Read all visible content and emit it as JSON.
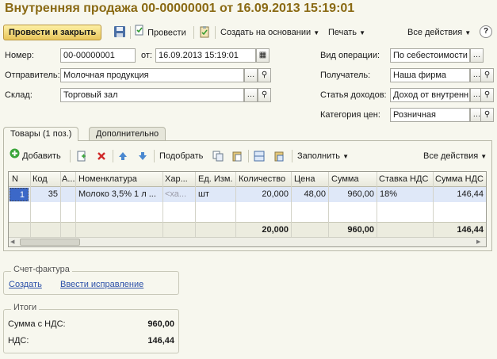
{
  "window": {
    "title": "Внутренняя продажа 00-00000001 от 16.09.2013 15:19:01"
  },
  "toolbar": {
    "post_close": "Провести и закрыть",
    "save_icon": "floppy-disk-icon",
    "post": "Провести",
    "create_based": "Создать на основании",
    "print": "Печать",
    "all_actions": "Все действия",
    "help": "?"
  },
  "form": {
    "number_label": "Номер:",
    "number_value": "00-00000001",
    "from_label": "от:",
    "date_value": "16.09.2013 15:19:01",
    "sender_label": "Отправитель:",
    "sender_value": "Молочная продукция",
    "warehouse_label": "Склад:",
    "warehouse_value": "Торговый зал",
    "operation_label": "Вид операции:",
    "operation_value": "По себестоимости",
    "recipient_label": "Получатель:",
    "recipient_value": "Наша фирма",
    "income_label": "Статья доходов:",
    "income_value": "Доход от внутренн",
    "price_category_label": "Категория цен:",
    "price_category_value": "Розничная"
  },
  "tabs": [
    {
      "label": "Товары (1 поз.)"
    },
    {
      "label": "Дополнительно"
    }
  ],
  "table_toolbar": {
    "add": "Добавить",
    "pick": "Подобрать",
    "fill": "Заполнить",
    "all_actions": "Все действия"
  },
  "table": {
    "headers": [
      "N",
      "Код",
      "А...",
      "Номенклатура",
      "Хар...",
      "Ед. Изм.",
      "Количество",
      "Цена",
      "Сумма",
      "Ставка НДС",
      "Сумма НДС"
    ],
    "rows": [
      [
        "1",
        "35",
        "",
        "Молоко 3,5% 1 л ...",
        "<ха...",
        "шт",
        "20,000",
        "48,00",
        "960,00",
        "18%",
        "146,44"
      ]
    ],
    "totals": {
      "quantity": "20,000",
      "sum": "960,00",
      "vat_sum": "146,44"
    }
  },
  "invoice": {
    "title": "Счет-фактура",
    "create": "Создать",
    "correct": "Ввести исправление"
  },
  "totals": {
    "title": "Итоги",
    "sum_vat_label": "Сумма с НДС:",
    "sum_vat_value": "960,00",
    "vat_label": "НДС:",
    "vat_value": "146,44"
  },
  "colors": {
    "title": "#8a6a14",
    "selection": "#dfe8f8",
    "link": "#2a4fa8"
  }
}
